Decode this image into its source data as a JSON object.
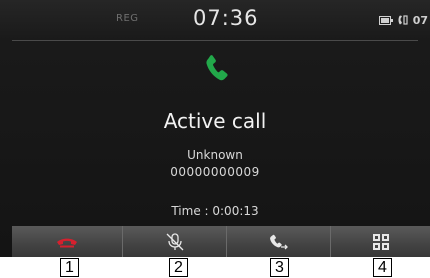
{
  "status_bar": {
    "band": "REG",
    "clock": "07:36",
    "phone_label": "07"
  },
  "call": {
    "status": "Active call",
    "caller_name": "Unknown",
    "caller_number": "00000000009",
    "timer": "Time : 0:00:13"
  },
  "toolbar": {
    "buttons": [
      {
        "name": "end-call-button",
        "icon": "end-call-icon"
      },
      {
        "name": "mute-mic-button",
        "icon": "mute-mic-icon"
      },
      {
        "name": "switch-to-handset-button",
        "icon": "switch-handset-icon"
      },
      {
        "name": "keypad-button",
        "icon": "keypad-icon"
      }
    ]
  },
  "callouts": [
    "1",
    "2",
    "3",
    "4"
  ],
  "colors": {
    "phone_icon": "#22a84a",
    "end_call": "#d6202e",
    "icon_light": "#e8e8e8"
  }
}
